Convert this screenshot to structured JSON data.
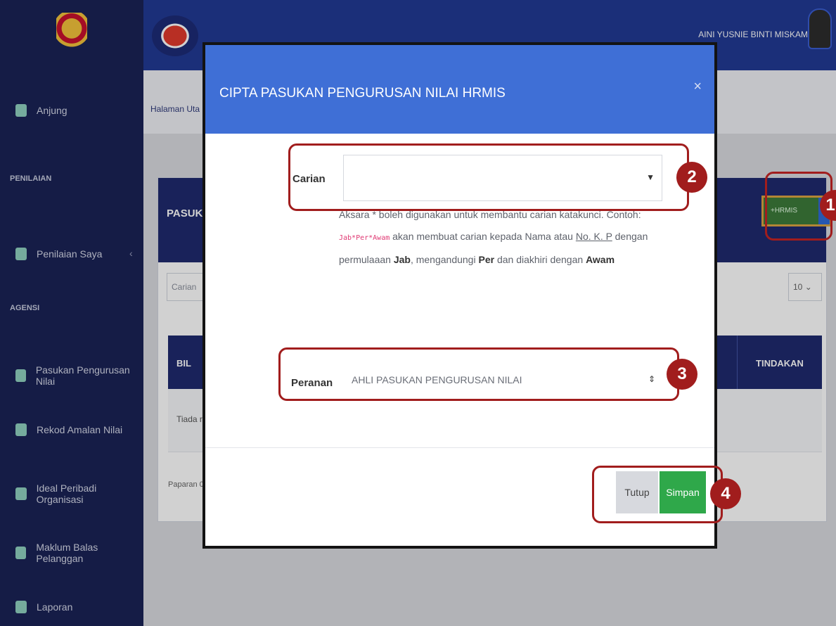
{
  "sidebar": {
    "sections": [
      "PENILAIAN",
      "AGENSI"
    ],
    "items": [
      {
        "label": "Anjung"
      },
      {
        "label": "Penilaian Saya"
      },
      {
        "label": "Pasukan Pengurusan Nilai"
      },
      {
        "label": "Rekod Amalan Nilai"
      },
      {
        "label": "Ideal Peribadi Organisasi"
      },
      {
        "label": "Maklum Balas Pelanggan"
      },
      {
        "label": "Laporan"
      }
    ]
  },
  "topbar": {
    "user_name": "AINI YUSNIE BINTI MISKAM"
  },
  "breadcrumb": "Halaman Uta",
  "card": {
    "title": "PASUKA",
    "hrmis_button": "+HRMIS",
    "search_placeholder": "Carian",
    "page_length": "10",
    "col_bil": "BIL",
    "col_tindakan": "TINDAKAN",
    "empty_row": "Tiada re",
    "paparan": "Paparan 0"
  },
  "modal": {
    "title": "CIPTA PASUKAN PENGURUSAN NILAI HRMIS",
    "close": "×",
    "carian_label": "Carian",
    "carian_value": "",
    "help_1": "Aksara * boleh digunakan untuk membantu carian katakunci. Contoh:",
    "help_code": "Jab*Per*Awam",
    "help_2": " akan membuat carian kepada Nama atau ",
    "help_nokp": "No. K. P",
    "help_3": " dengan",
    "help_4": "permulaaan ",
    "help_jab": "Jab",
    "help_5": ", mengandungi ",
    "help_per": "Per",
    "help_6": " dan diakhiri dengan ",
    "help_awam": "Awam",
    "peranan_label": "Peranan",
    "peranan_value": "AHLI PASUKAN PENGURUSAN NILAI",
    "btn_tutup": "Tutup",
    "btn_simpan": "Simpan"
  },
  "annotations": [
    "1",
    "2",
    "3",
    "4"
  ],
  "colors": {
    "annotation": "#a11d1d",
    "modal_header": "#3f6fd6",
    "save": "#2fa84a",
    "sidebar": "#1a2356"
  }
}
